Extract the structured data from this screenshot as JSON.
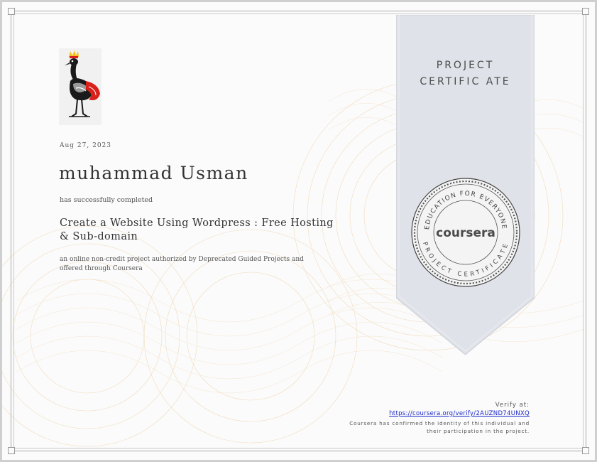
{
  "certificate": {
    "date": "Aug 27, 2023",
    "recipient": "muhammad Usman",
    "completed_text": "has successfully completed",
    "course_title": "Create a Website Using Wordpress : Free Hosting & Sub-domain",
    "description": "an online non-credit project authorized by Deprecated Guided Projects and offered through Coursera"
  },
  "ribbon": {
    "line1": "PROJECT",
    "line2": "CERTIFIC ATE"
  },
  "seal": {
    "top_arc": "EDUCATION FOR EVERYONE",
    "brand": "coursera",
    "bottom_arc": "PROJECT CERTIFICATE"
  },
  "verify": {
    "label": "Verify at:",
    "url": "https://coursera.org/verify/2AUZND74UNXQ",
    "note_line1": "Coursera has confirmed the identity of this individual and",
    "note_line2": "their participation in the project."
  },
  "colors": {
    "link": "#1a27c9",
    "ribbon": "#dfe2e8",
    "guilloche": "#f2d9b8",
    "logo_red": "#d9201b",
    "logo_yellow": "#f4c01a"
  },
  "icons": {
    "logo": "crowned-crane-logo-icon",
    "seal": "coursera-seal-icon"
  }
}
